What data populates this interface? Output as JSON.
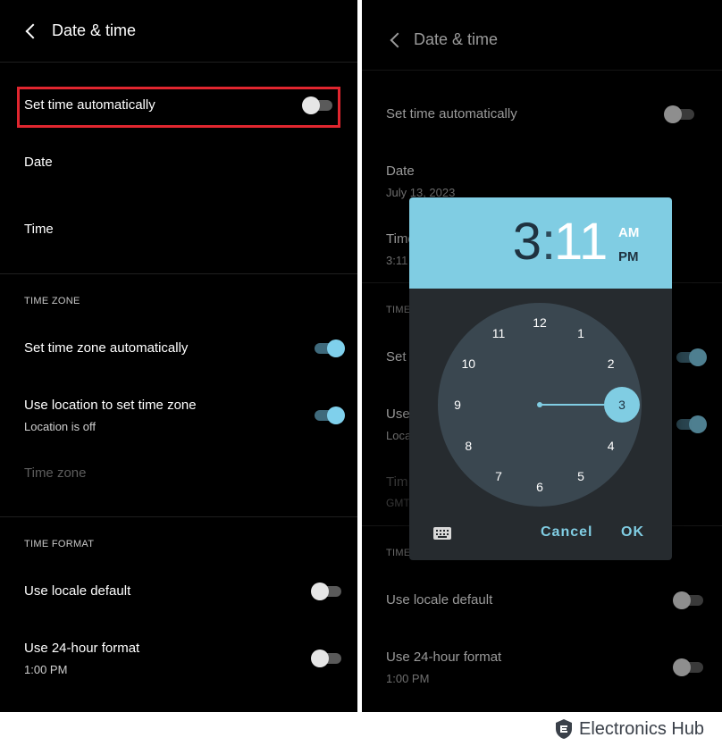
{
  "left_screen": {
    "header_title": "Date & time",
    "set_time_auto_label": "Set time automatically",
    "set_time_auto_on": false,
    "date_label": "Date",
    "time_label": "Time",
    "time_zone_section": "TIME ZONE",
    "set_tz_auto_label": "Set time zone automatically",
    "set_tz_auto_on": true,
    "use_location_label": "Use location to set time zone",
    "use_location_sub": "Location is off",
    "use_location_on": true,
    "time_zone_label": "Time zone",
    "time_format_section": "TIME FORMAT",
    "locale_default_label": "Use locale default",
    "locale_default_on": false,
    "use_24h_label": "Use 24-hour format",
    "use_24h_sub": "1:00 PM",
    "use_24h_on": false
  },
  "right_screen": {
    "header_title": "Date & time",
    "set_time_auto_label": "Set time automatically",
    "date_label": "Date",
    "date_value": "July 13, 2023",
    "time_label": "Time",
    "time_value": "3:11",
    "time_zone_section": "TIME",
    "set_tz_partial": "Set",
    "use_location_partial": "Use",
    "use_location_sub_partial": "Loca",
    "time_zone_partial": "Tim",
    "gmt_partial": "GMT",
    "time_format_section": "TIME",
    "locale_default_label": "Use locale default",
    "use_24h_label": "Use 24-hour format",
    "use_24h_sub": "1:00 PM"
  },
  "time_picker": {
    "hour": "3",
    "colon": ":",
    "minute": "11",
    "am_label": "AM",
    "pm_label": "PM",
    "selected_period": "AM",
    "clock_numbers": [
      "12",
      "1",
      "2",
      "3",
      "4",
      "5",
      "6",
      "7",
      "8",
      "9",
      "10",
      "11"
    ],
    "selected_number": "3",
    "cancel_label": "Cancel",
    "ok_label": "OK",
    "keyboard_icon": "keyboard-icon"
  },
  "watermark": {
    "brand": "Electronics Hub"
  },
  "colors": {
    "accent": "#80cde3",
    "highlight_border": "#e0262f",
    "background": "#000000",
    "toggle_on": "#7fd0ec"
  }
}
